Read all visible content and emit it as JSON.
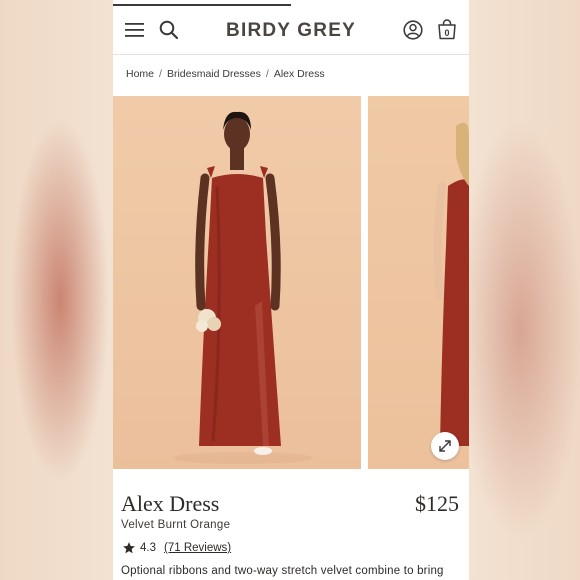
{
  "header": {
    "brand": "BIRDY GREY",
    "cart_count": "0"
  },
  "breadcrumb": {
    "items": [
      "Home",
      "Bridesmaid Dresses",
      "Alex Dress"
    ]
  },
  "gallery": {
    "main_image_alt": "model-in-alex-dress",
    "second_image_alt": "model-in-alex-dress-side"
  },
  "product": {
    "name": "Alex Dress",
    "price": "$125",
    "color": "Velvet Burnt Orange",
    "rating": "4.3",
    "reviews_label": "(71 Reviews)",
    "description": "Optional ribbons and two-way stretch velvet combine to bring"
  },
  "colors": {
    "dress": "#9c2e22",
    "backdrop": "#f0c9a5",
    "text": "#2e2a27"
  }
}
